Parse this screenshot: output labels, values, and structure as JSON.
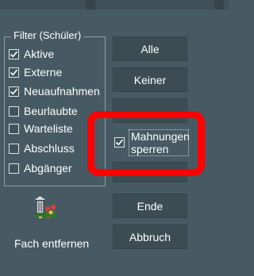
{
  "filter": {
    "title": "Filter (Schüler)",
    "items": [
      {
        "label": "Aktive",
        "checked": true
      },
      {
        "label": "Externe",
        "checked": true
      },
      {
        "label": "Neuaufnahmen",
        "checked": true
      },
      {
        "label": "Beurlaubte",
        "checked": false
      },
      {
        "label": "Warteliste",
        "checked": false
      },
      {
        "label": "Abschluss",
        "checked": false
      },
      {
        "label": "Abgänger",
        "checked": false
      }
    ]
  },
  "buttons": {
    "alle": "Alle",
    "keiner": "Keiner",
    "ende": "Ende",
    "abbruch": "Abbruch"
  },
  "mahnungen": {
    "line1": "Mahnungen",
    "line2": "sperren",
    "checked": true
  },
  "fach_entfernen": {
    "label": "Fach entfernen",
    "icon": "trash-can-icon"
  },
  "colors": {
    "background": "#475a63",
    "button": "#3b4c53",
    "annotation": "#ff0000"
  }
}
